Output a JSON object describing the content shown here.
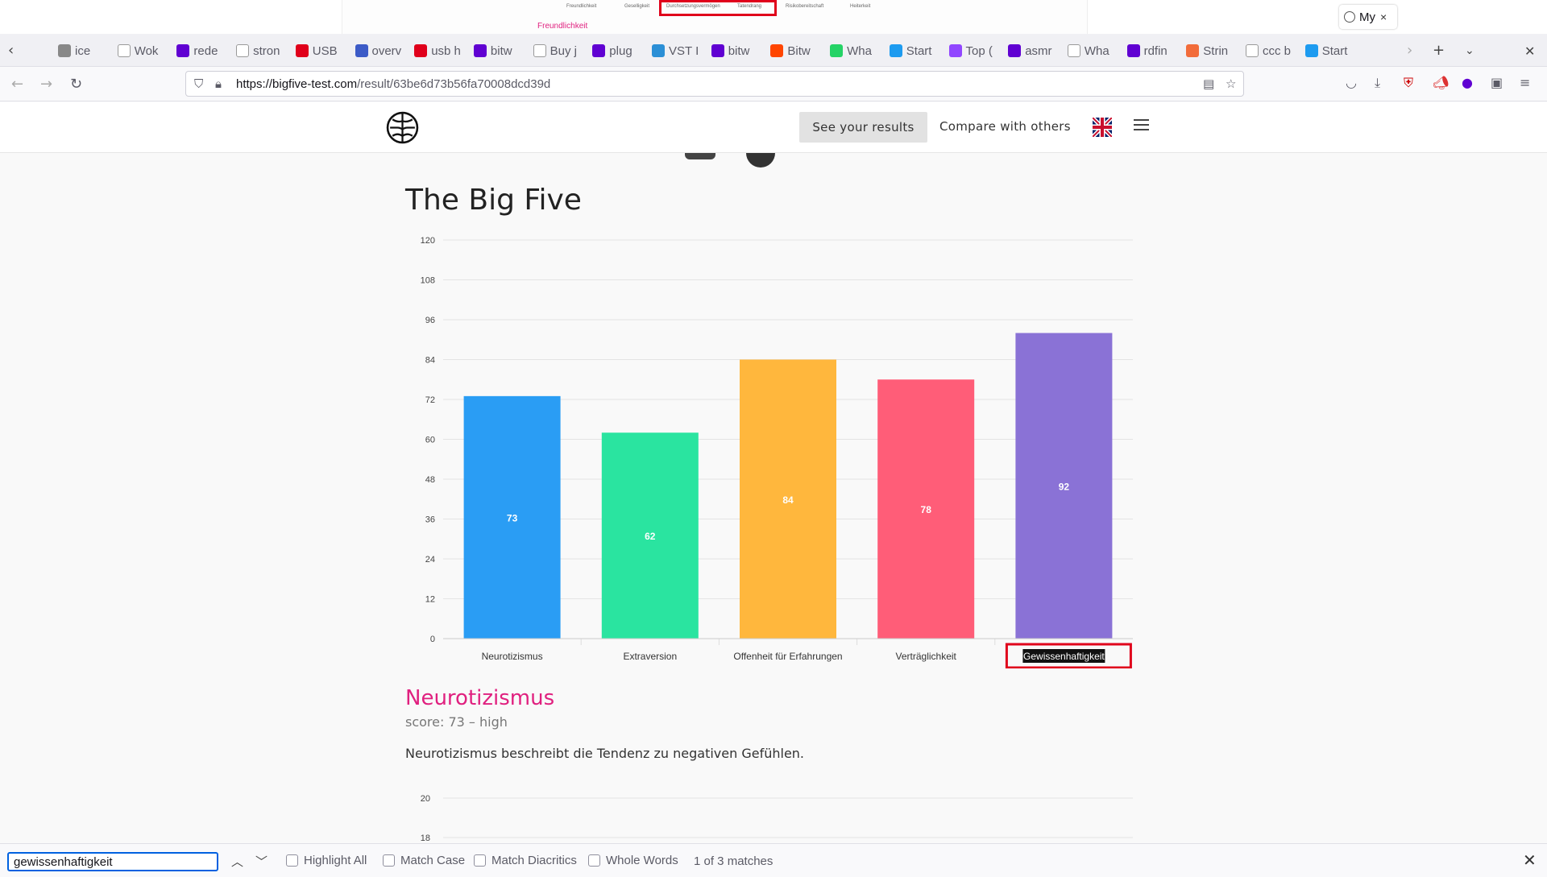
{
  "top_fragment": {
    "labels": [
      "Freundlichkeit",
      "Geselligkeit",
      "Durchsetzungsvermögen",
      "Tatendrang",
      "Risikobereitschaft",
      "Heiterkeit"
    ],
    "subtitle": "Freundlichkeit"
  },
  "tabs": [
    {
      "title": "ice",
      "color": "#888888",
      "icon": "generic-icon"
    },
    {
      "title": "Wok",
      "color": "#ffffff",
      "icon": "wikipedia-icon"
    },
    {
      "title": "rede",
      "color": "#6001d2",
      "icon": "yahoo-icon"
    },
    {
      "title": "stron",
      "color": "#ffffff",
      "icon": "google-icon"
    },
    {
      "title": "USB",
      "color": "#e0001b",
      "icon": "b-icon"
    },
    {
      "title": "overv",
      "color": "#3c5bc7",
      "icon": "stack-icon"
    },
    {
      "title": "usb h",
      "color": "#e0001b",
      "icon": "red-icon"
    },
    {
      "title": "bitw",
      "color": "#6001d2",
      "icon": "yahoo-icon"
    },
    {
      "title": "Buy j",
      "color": "#ffffff",
      "icon": "generic-icon"
    },
    {
      "title": "plug",
      "color": "#6001d2",
      "icon": "yahoo-icon"
    },
    {
      "title": "VST I",
      "color": "#2b8fd6",
      "icon": "music-icon"
    },
    {
      "title": "bitw",
      "color": "#6001d2",
      "icon": "yahoo-icon"
    },
    {
      "title": "Bitw",
      "color": "#ff4500",
      "icon": "reddit-icon"
    },
    {
      "title": "Wha",
      "color": "#25d366",
      "icon": "whatsapp-icon"
    },
    {
      "title": "Start",
      "color": "#1d9bf0",
      "icon": "twitter-icon"
    },
    {
      "title": "Top (",
      "color": "#9146ff",
      "icon": "twitch-icon"
    },
    {
      "title": "asmr",
      "color": "#6001d2",
      "icon": "yahoo-icon"
    },
    {
      "title": "Wha",
      "color": "#ffffff",
      "icon": "generic-icon"
    },
    {
      "title": "rdfin",
      "color": "#6001d2",
      "icon": "yahoo-icon"
    },
    {
      "title": "Strin",
      "color": "#f26c3a",
      "icon": "generic-icon"
    },
    {
      "title": "ccc b",
      "color": "#ffffff",
      "icon": "google-icon"
    },
    {
      "title": "Start",
      "color": "#1d9bf0",
      "icon": "twitter-icon"
    }
  ],
  "active_tab": {
    "title": "My",
    "close": "×"
  },
  "url": {
    "host": "https://bigfive-test.com",
    "path": "/result/63be6d73b56fa70008dcd39d"
  },
  "header": {
    "see_results": "See your results",
    "compare": "Compare with others"
  },
  "page": {
    "title": "The Big Five",
    "section_title": "Neurotizismus",
    "score_line": "score: 73 – high",
    "description": "Neurotizismus beschreibt die Tendenz zu negativen Gefühlen."
  },
  "chart_data": [
    {
      "type": "bar",
      "title": "",
      "categories": [
        "Neurotizismus",
        "Extraversion",
        "Offenheit für Erfahrungen",
        "Verträglichkeit",
        "Gewissenhaftigkeit"
      ],
      "values": [
        73,
        62,
        84,
        78,
        92
      ],
      "colors": [
        "#2a9df4",
        "#2ae4a0",
        "#ffb73d",
        "#ff5d78",
        "#8a72d6"
      ],
      "ylim": [
        0,
        120
      ],
      "yticks": [
        0,
        12,
        24,
        36,
        48,
        60,
        72,
        84,
        96,
        108,
        120
      ],
      "grid": true,
      "highlighted_category": "Gewissenhaftigkeit"
    },
    {
      "type": "bar",
      "title": "",
      "yticks_visible": [
        18,
        20
      ],
      "grid": true
    }
  ],
  "findbar": {
    "query": "gewissenhaftigkeit",
    "highlight_all": "Highlight All",
    "match_case": "Match Case",
    "match_diacritics": "Match Diacritics",
    "whole_words": "Whole Words",
    "match_count": "1 of 3 matches"
  }
}
